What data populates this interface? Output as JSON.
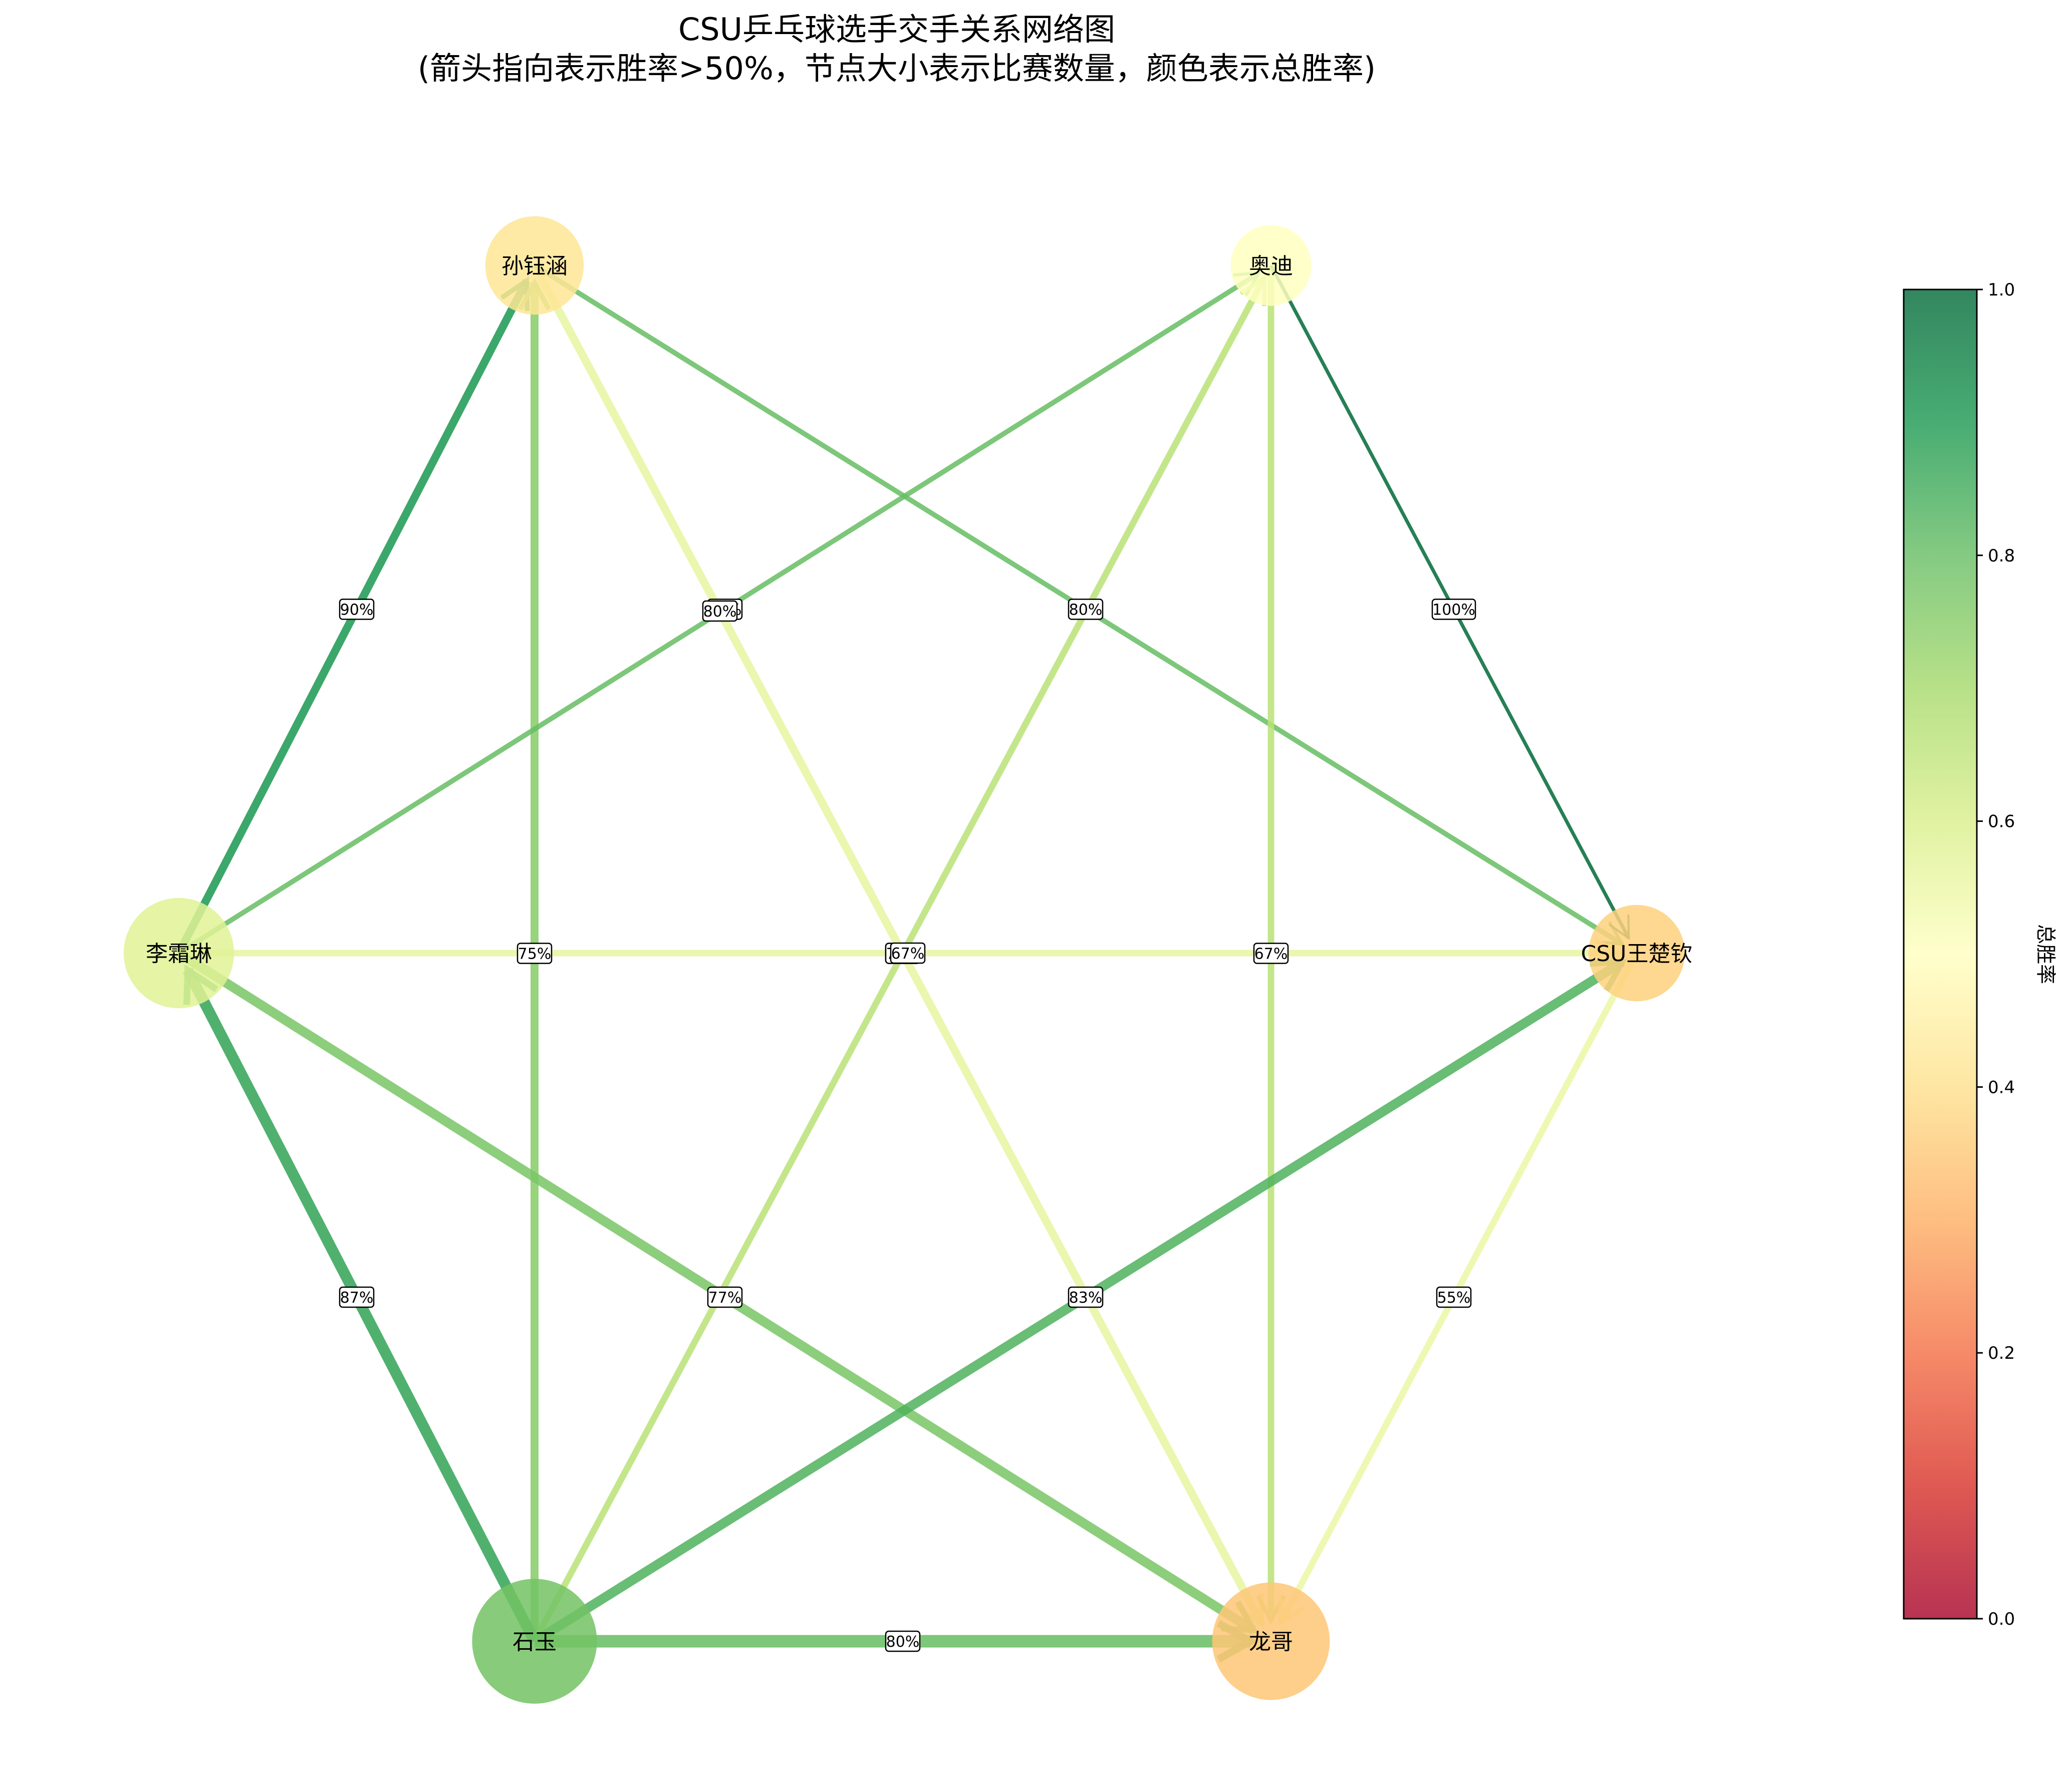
{
  "title": {
    "line1": "CSU乒乓球选手交手关系网络图",
    "line2": "(箭头指向表示胜率>50%，节点大小表示比赛数量，颜色表示总胜率)"
  },
  "colorbar": {
    "label": "总胜率",
    "ticks": [
      "0.0",
      "0.2",
      "0.4",
      "0.6",
      "0.8",
      "1.0"
    ],
    "range": [
      0,
      1
    ],
    "colormap": [
      "#a50026",
      "#d73027",
      "#f46d43",
      "#fdae61",
      "#fee08b",
      "#ffffbf",
      "#d9ef8b",
      "#a6d96a",
      "#66bd63",
      "#1a9850",
      "#006837"
    ]
  },
  "nodes": [
    {
      "id": "sun",
      "label": "孙钰涵",
      "win_rate": 0.42,
      "matches": 30
    },
    {
      "id": "audi",
      "label": "奥迪",
      "win_rate": 0.5,
      "matches": 15
    },
    {
      "id": "li",
      "label": "李霜琳",
      "win_rate": 0.58,
      "matches": 43
    },
    {
      "id": "wang",
      "label": "CSU王楚钦",
      "win_rate": 0.37,
      "matches": 28
    },
    {
      "id": "shi",
      "label": "石玉",
      "win_rate": 0.78,
      "matches": 62
    },
    {
      "id": "long",
      "label": "龙哥",
      "win_rate": 0.35,
      "matches": 52
    }
  ],
  "edges": [
    {
      "source": "li",
      "target": "sun",
      "label": "90%",
      "win_rate": 0.9,
      "weight": 4
    },
    {
      "source": "shi",
      "target": "sun",
      "label": "75%",
      "win_rate": 0.75,
      "weight": 4
    },
    {
      "source": "sun",
      "target": "long",
      "label": "83%",
      "win_rate": 0.56,
      "weight": 4
    },
    {
      "source": "sun",
      "target": "wang",
      "label": "80%",
      "win_rate": 0.8,
      "weight": 2
    },
    {
      "source": "li",
      "target": "audi",
      "label": "80%",
      "win_rate": 0.8,
      "weight": 2
    },
    {
      "source": "shi",
      "target": "audi",
      "label": "77%",
      "win_rate": 0.66,
      "weight": 3
    },
    {
      "source": "audi",
      "target": "long",
      "label": "67%",
      "win_rate": 0.66,
      "weight": 3
    },
    {
      "source": "audi",
      "target": "wang",
      "label": "100%",
      "win_rate": 1.0,
      "weight": 1
    },
    {
      "source": "li",
      "target": "wang",
      "label": "67%",
      "win_rate": 0.56,
      "weight": 3
    },
    {
      "source": "shi",
      "target": "li",
      "label": "87%",
      "win_rate": 0.87,
      "weight": 6
    },
    {
      "source": "li",
      "target": "long",
      "label": "77%",
      "win_rate": 0.77,
      "weight": 5
    },
    {
      "source": "shi",
      "target": "wang",
      "label": "83%",
      "win_rate": 0.83,
      "weight": 5
    },
    {
      "source": "wang",
      "target": "long",
      "label": "55%",
      "win_rate": 0.55,
      "weight": 3
    },
    {
      "source": "shi",
      "target": "long",
      "label": "80%",
      "win_rate": 0.8,
      "weight": 7
    }
  ],
  "center_labels": [
    "80%",
    "80%",
    "67%"
  ],
  "side_labels": [
    "75%",
    "67%"
  ]
}
